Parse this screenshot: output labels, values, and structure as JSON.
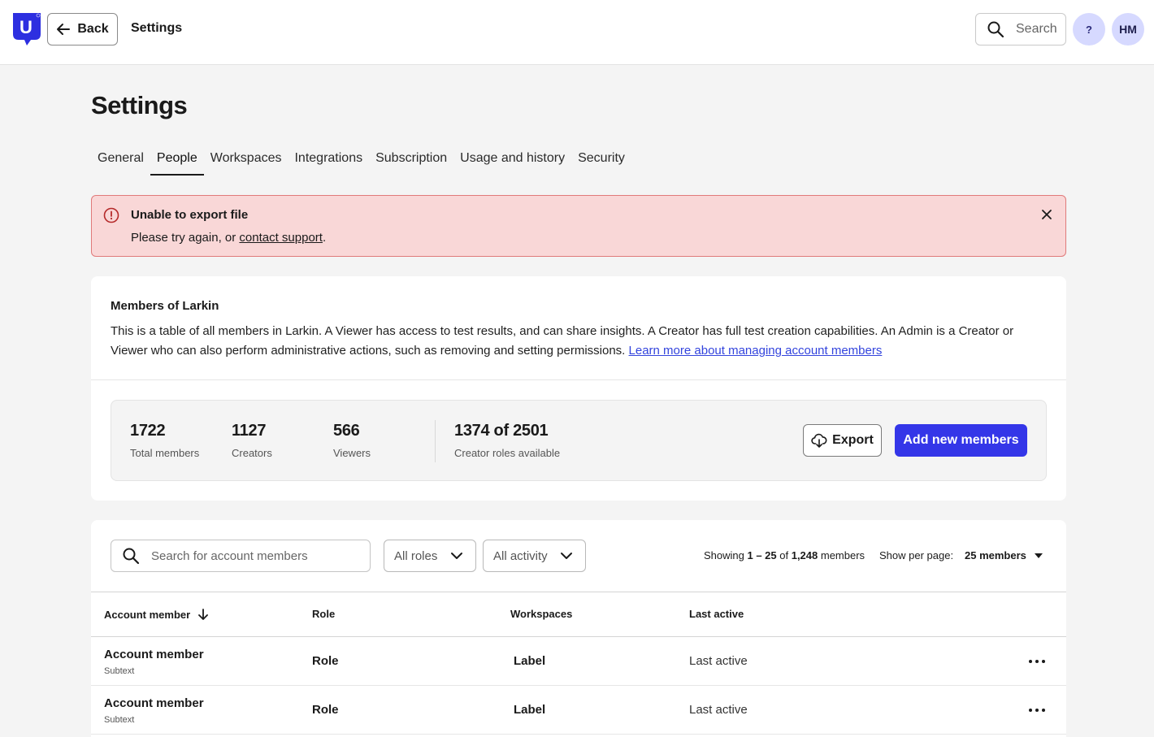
{
  "header": {
    "logo_letter": "U",
    "back_label": "Back",
    "title": "Settings",
    "search_label": "Search",
    "help_label": "?",
    "avatar_initials": "HM"
  },
  "page": {
    "title": "Settings"
  },
  "tabs": [
    {
      "label": "General",
      "active": false
    },
    {
      "label": "People",
      "active": true
    },
    {
      "label": "Workspaces",
      "active": false
    },
    {
      "label": "Integrations",
      "active": false
    },
    {
      "label": "Subscription",
      "active": false
    },
    {
      "label": "Usage and history",
      "active": false
    },
    {
      "label": "Security",
      "active": false
    }
  ],
  "alert": {
    "title": "Unable to export file",
    "text_before": "Please try again, or ",
    "link": "contact support",
    "text_after": "."
  },
  "members": {
    "heading": "Members of Larkin",
    "description": "This is a table of all members in Larkin. A Viewer has access to test results, and can share insights. A Creator has full test creation capabilities. An Admin is a Creator or Viewer who can also perform administrative actions, such as removing and setting permissions. ",
    "learn_more_link": "Learn more about managing account members",
    "stats": [
      {
        "value": "1722",
        "label": "Total members"
      },
      {
        "value": "1127",
        "label": "Creators"
      },
      {
        "value": "566",
        "label": "Viewers"
      },
      {
        "value": "1374 of 2501",
        "label": "Creator roles available"
      }
    ],
    "export_label": "Export",
    "add_label": "Add new members"
  },
  "table": {
    "search_placeholder": "Search for account members",
    "filter_roles": "All roles",
    "filter_activity": "All activity",
    "showing_prefix": "Showing ",
    "showing_range": "1 – 25",
    "showing_of": " of ",
    "showing_total": "1,248",
    "showing_suffix": " members",
    "per_page_label": "Show per page:",
    "per_page_value": "25 members",
    "columns": {
      "member": "Account member",
      "role": "Role",
      "workspaces": "Workspaces",
      "last_active": "Last active"
    },
    "rows": [
      {
        "name": "Account member",
        "subtext": "Subtext",
        "role": "Role",
        "workspaces": "Label",
        "last_active": "Last active"
      },
      {
        "name": "Account member",
        "subtext": "Subtext",
        "role": "Role",
        "workspaces": "Label",
        "last_active": "Last active"
      }
    ]
  },
  "colors": {
    "accent": "#3436e8",
    "alert_bg": "#f9d7d7",
    "alert_border": "#e07a7a",
    "avatar_bg": "#d6d9ff"
  },
  "icons": {
    "logo": "brand-logo",
    "back": "arrow-left-icon",
    "search": "search-icon",
    "alert": "alert-circle-icon",
    "close": "close-icon",
    "export": "cloud-download-icon",
    "chevron": "chevron-down-icon",
    "sort": "arrow-down-icon",
    "more": "more-horizontal-icon"
  }
}
